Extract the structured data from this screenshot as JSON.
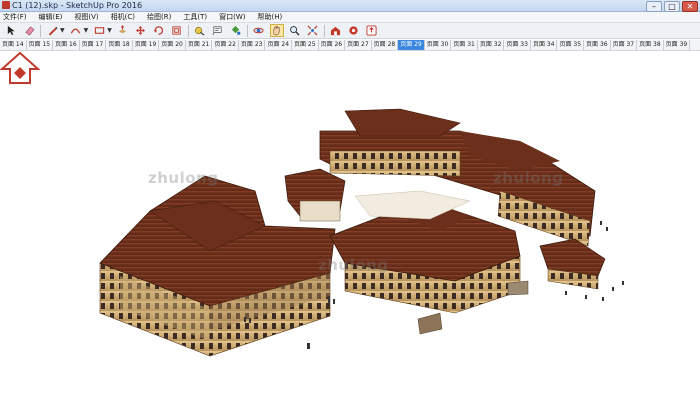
{
  "window": {
    "title": "C1 (12).skp - SketchUp Pro 2016",
    "buttons": {
      "minimize": "–",
      "maximize": "□",
      "close": "✕"
    }
  },
  "menubar": {
    "items": [
      "文件(F)",
      "编辑(E)",
      "视图(V)",
      "相机(C)",
      "绘图(R)",
      "工具(T)",
      "窗口(W)",
      "帮助(H)"
    ]
  },
  "toolbar": {
    "tools": [
      "select-icon",
      "eraser-icon",
      "pencil-line-icon",
      "arc-icon",
      "rectangle-icon",
      "push-pull-icon",
      "move-icon",
      "rotate-icon",
      "offset-icon",
      "tape-measure-icon",
      "text-icon",
      "paint-bucket-icon",
      "orbit-icon",
      "pan-icon",
      "zoom-icon",
      "zoom-extents-icon",
      "warehouse-icon",
      "extension-icon",
      "share-icon"
    ],
    "active_tool": "pan-icon"
  },
  "scenes": {
    "tabs": [
      "页面 14",
      "页面 15",
      "页面 16",
      "页面 17",
      "页面 18",
      "页面 19",
      "页面 20",
      "页面 21",
      "页面 22",
      "页面 23",
      "页面 24",
      "页面 25",
      "页面 26",
      "页面 27",
      "页面 28",
      "页面 29",
      "页面 30",
      "页面 31",
      "页面 32",
      "页面 33",
      "页面 34",
      "页面 35",
      "页面 36",
      "页面 37",
      "页面 38",
      "页面 39"
    ],
    "active_index": 15
  },
  "viewport": {
    "watermarks": [
      "zhulong",
      "zhulong",
      "zhulong"
    ],
    "colors": {
      "roof": "#7a3a24",
      "roof_dark": "#5b2816",
      "wall": "#d8b97f",
      "wall_dark": "#9b7b4d"
    }
  }
}
